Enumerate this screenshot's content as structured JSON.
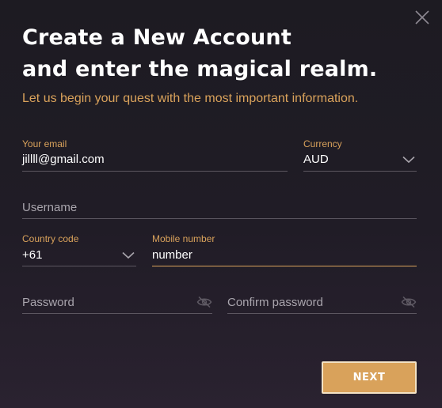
{
  "header": {
    "title_line1": "Create a New Account",
    "title_line2": "and enter the magical realm.",
    "subtitle": "Let us begin your quest with the most important information.",
    "close_icon": "close-icon"
  },
  "form": {
    "email": {
      "label": "Your email",
      "value": "jillll@gmail.com"
    },
    "currency": {
      "label": "Currency",
      "value": "AUD",
      "icon": "chevron-down-icon"
    },
    "username": {
      "placeholder": "Username"
    },
    "country_code": {
      "label": "Country code",
      "value": "+61",
      "icon": "chevron-down-icon"
    },
    "mobile": {
      "label": "Mobile number",
      "value": "number"
    },
    "password": {
      "placeholder": "Password",
      "icon": "eye-off-icon"
    },
    "confirm_password": {
      "placeholder": "Confirm password",
      "icon": "eye-off-icon"
    }
  },
  "actions": {
    "next_label": "NEXT"
  },
  "colors": {
    "accent": "#d9a25b",
    "background": "#1f1c24",
    "text": "#ffffff",
    "muted": "#a9a5ad",
    "divider": "#5c5660"
  }
}
